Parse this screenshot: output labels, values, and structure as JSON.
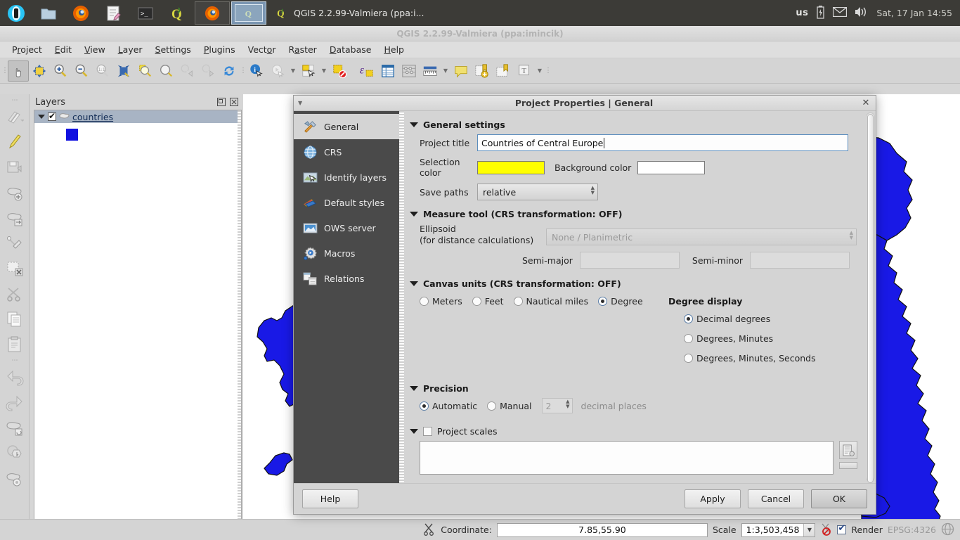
{
  "taskbar": {
    "launchers": [
      "app-menu-icon",
      "files-icon",
      "firefox-icon",
      "text-editor-icon",
      "terminal-icon",
      "qgis-icon"
    ],
    "windows": [
      {
        "icon": "firefox-icon",
        "active": false
      },
      {
        "icon": "qgis-icon",
        "active": true
      }
    ],
    "active_window_title": "QGIS 2.2.99-Valmiera (ppa:i...",
    "keyboard_layout": "us",
    "tray_icons": [
      "battery-icon",
      "mail-icon",
      "volume-icon"
    ],
    "clock": "Sat, 17 Jan  14:55"
  },
  "window": {
    "title": "QGIS 2.2.99-Valmiera (ppa:imincik)"
  },
  "menubar": {
    "items": [
      {
        "label": "Project",
        "mnemonic_index": 1
      },
      {
        "label": "Edit",
        "mnemonic_index": 0
      },
      {
        "label": "View",
        "mnemonic_index": 0
      },
      {
        "label": "Layer",
        "mnemonic_index": 0
      },
      {
        "label": "Settings",
        "mnemonic_index": 0
      },
      {
        "label": "Plugins",
        "mnemonic_index": 0
      },
      {
        "label": "Vector",
        "mnemonic_index": 4
      },
      {
        "label": "Raster",
        "mnemonic_index": 1
      },
      {
        "label": "Database",
        "mnemonic_index": 0
      },
      {
        "label": "Help",
        "mnemonic_index": 0
      }
    ]
  },
  "toolbar": {
    "buttons": [
      "pan-map-icon",
      "pan-to-selection-icon",
      "zoom-in-icon",
      "zoom-out-icon",
      "zoom-native-icon",
      "zoom-full-icon",
      "zoom-to-selection-icon",
      "zoom-to-layer-icon",
      "zoom-last-icon",
      "zoom-next-icon",
      "refresh-icon",
      "identify-features-icon",
      "run-feature-action-icon",
      "select-features-icon",
      "deselect-features-icon",
      "expression-select-icon",
      "open-attribute-table-icon",
      "field-calculator-icon",
      "measure-line-icon",
      "map-tips-icon",
      "new-bookmark-icon",
      "show-bookmarks-icon",
      "text-annotation-icon"
    ]
  },
  "left_toolbar": {
    "buttons": [
      "current-edits-icon",
      "toggle-editing-icon",
      "save-layer-edits-icon",
      "add-feature-icon",
      "move-feature-icon",
      "node-tool-icon",
      "delete-selected-icon",
      "cut-features-icon",
      "copy-features-icon",
      "paste-features-icon",
      "undo-icon",
      "redo-icon",
      "rotate-feature-icon",
      "simplify-feature-icon",
      "add-part-icon"
    ]
  },
  "layers_panel": {
    "title": "Layers",
    "header_buttons": [
      "undock-icon",
      "close-icon"
    ],
    "layers": [
      {
        "name": "countries",
        "checked": true,
        "symbol_color": "#1111e0",
        "expanded": true
      }
    ]
  },
  "map": {
    "fill_color": "#1919e6",
    "stroke_color": "#000000",
    "background": "#ffffff"
  },
  "statusbar": {
    "ready_icon": "render-busy-icon",
    "coordinate_label": "Coordinate:",
    "coordinate_value": "7.85,55.90",
    "scale_label": "Scale",
    "scale_value": "1:3,503,458",
    "scale_lock_icon": "lock-scale-icon",
    "render_label": "Render",
    "render_checked": true,
    "crs_label": "EPSG:4326",
    "crs_icon": "crs-status-icon"
  },
  "dialog": {
    "title": "Project Properties | General",
    "close_icon": "close-icon",
    "menu_icon": "window-menu-icon",
    "sidebar": [
      {
        "label": "General",
        "icon": "tools-icon",
        "active": true
      },
      {
        "label": "CRS",
        "icon": "globe-icon",
        "active": false
      },
      {
        "label": "Identify layers",
        "icon": "identify-layers-icon",
        "active": false
      },
      {
        "label": "Default styles",
        "icon": "paintbrush-icon",
        "active": false
      },
      {
        "label": "OWS server",
        "icon": "ows-server-icon",
        "active": false
      },
      {
        "label": "Macros",
        "icon": "macros-gear-icon",
        "active": false
      },
      {
        "label": "Relations",
        "icon": "relations-icon",
        "active": false
      }
    ],
    "general_settings": {
      "group_title": "General settings",
      "project_title_label": "Project title",
      "project_title_value": "Countries of Central Europe",
      "selection_color_label": "Selection color",
      "selection_color_value": "#ffff00",
      "background_color_label": "Background color",
      "background_color_value": "#ffffff",
      "save_paths_label": "Save paths",
      "save_paths_value": "relative"
    },
    "measure_tool": {
      "group_title": "Measure tool (CRS transformation: OFF)",
      "ellipsoid_label_line1": "Ellipsoid",
      "ellipsoid_label_line2": "(for distance calculations)",
      "ellipsoid_value": "None / Planimetric",
      "semi_major_label": "Semi-major",
      "semi_major_value": "",
      "semi_minor_label": "Semi-minor",
      "semi_minor_value": ""
    },
    "canvas_units": {
      "group_title": "Canvas units (CRS transformation: OFF)",
      "options": [
        {
          "label": "Meters",
          "selected": false
        },
        {
          "label": "Feet",
          "selected": false
        },
        {
          "label": "Nautical miles",
          "selected": false
        },
        {
          "label": "Degree",
          "selected": true
        }
      ],
      "degree_display_label": "Degree display",
      "degree_options": [
        {
          "label": "Decimal degrees",
          "selected": true
        },
        {
          "label": "Degrees, Minutes",
          "selected": false
        },
        {
          "label": "Degrees, Minutes, Seconds",
          "selected": false
        }
      ]
    },
    "precision": {
      "group_title": "Precision",
      "options": [
        {
          "label": "Automatic",
          "selected": true
        },
        {
          "label": "Manual",
          "selected": false
        }
      ],
      "decimal_value": "2",
      "decimal_label": "decimal places"
    },
    "project_scales": {
      "group_title": "Project scales",
      "checked": false,
      "list_value": "",
      "side_buttons": [
        "add-scale-icon"
      ]
    },
    "footer": {
      "help_label": "Help",
      "apply_label": "Apply",
      "cancel_label": "Cancel",
      "ok_label": "OK"
    }
  }
}
